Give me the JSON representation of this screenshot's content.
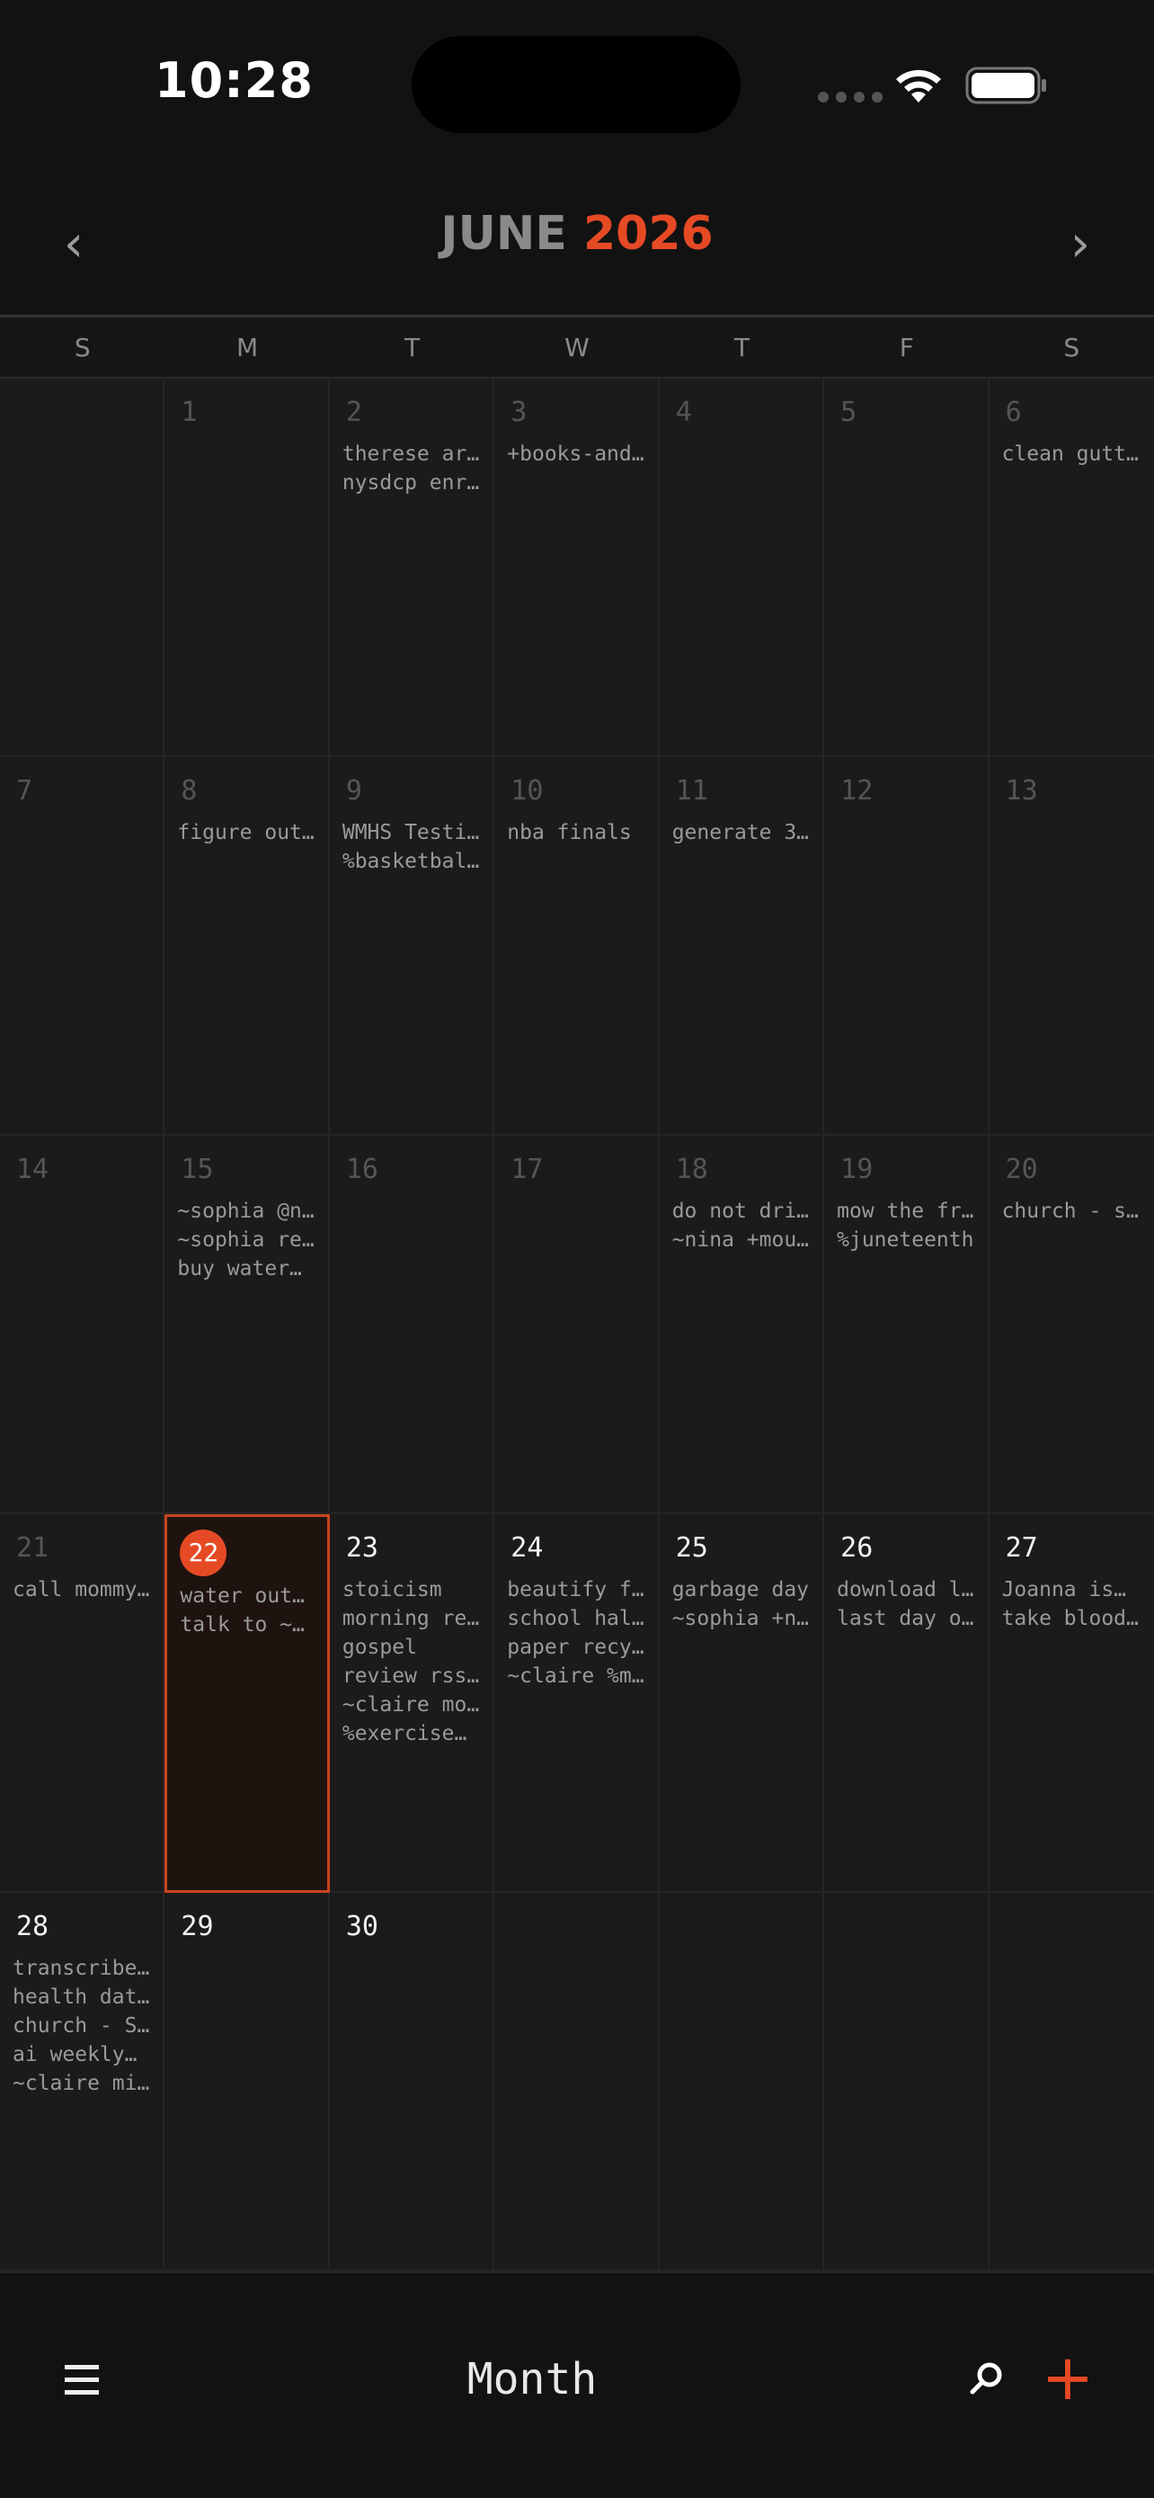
{
  "status": {
    "time": "10:28"
  },
  "header": {
    "month": "JUNE",
    "year": "2026",
    "prev": "‹",
    "next": "›"
  },
  "weekdays": [
    "S",
    "M",
    "T",
    "W",
    "T",
    "F",
    "S"
  ],
  "days": [
    {
      "num": "",
      "events": []
    },
    {
      "num": "1",
      "events": []
    },
    {
      "num": "2",
      "events": [
        "therese ar…",
        "nysdcp enr…"
      ]
    },
    {
      "num": "3",
      "events": [
        "+books-and…"
      ]
    },
    {
      "num": "4",
      "events": []
    },
    {
      "num": "5",
      "events": []
    },
    {
      "num": "6",
      "events": [
        "clean gutt…"
      ]
    },
    {
      "num": "7",
      "events": []
    },
    {
      "num": "8",
      "events": [
        "figure out…"
      ]
    },
    {
      "num": "9",
      "events": [
        "WMHS Testi…",
        "%basketbal…"
      ]
    },
    {
      "num": "10",
      "events": [
        "nba finals"
      ]
    },
    {
      "num": "11",
      "events": [
        "generate 3…"
      ]
    },
    {
      "num": "12",
      "events": []
    },
    {
      "num": "13",
      "events": []
    },
    {
      "num": "14",
      "events": []
    },
    {
      "num": "15",
      "events": [
        "~sophia @n…",
        "~sophia re…",
        "buy water…"
      ]
    },
    {
      "num": "16",
      "events": []
    },
    {
      "num": "17",
      "events": []
    },
    {
      "num": "18",
      "events": [
        "do not dri…",
        "~nina +mou…"
      ]
    },
    {
      "num": "19",
      "events": [
        "mow the fr…",
        "%juneteenth"
      ]
    },
    {
      "num": "20",
      "events": [
        "church - s…"
      ]
    },
    {
      "num": "21",
      "events": [
        "call mommy…"
      ]
    },
    {
      "num": "22",
      "today": true,
      "events": [
        "water outd…",
        "talk to ~s…"
      ]
    },
    {
      "num": "23",
      "current": true,
      "events": [
        "stoicism",
        "morning re…",
        "gospel",
        "review rss…",
        "~claire mo…",
        "%exercise…"
      ]
    },
    {
      "num": "24",
      "current": true,
      "events": [
        "beautify f…",
        "school hal…",
        "paper recy…",
        "~claire %m…"
      ]
    },
    {
      "num": "25",
      "current": true,
      "events": [
        "garbage day",
        "~sophia +n…"
      ]
    },
    {
      "num": "26",
      "current": true,
      "events": [
        "download l…",
        "last day o…"
      ]
    },
    {
      "num": "27",
      "current": true,
      "events": [
        "Joanna is…",
        "take blood…"
      ]
    },
    {
      "num": "28",
      "current": true,
      "events": [
        "transcribe…",
        "health dat…",
        "church - S…",
        "ai weekly…",
        "~claire mi…"
      ]
    },
    {
      "num": "29",
      "current": true,
      "events": []
    },
    {
      "num": "30",
      "current": true,
      "events": []
    },
    {
      "num": "",
      "events": []
    },
    {
      "num": "",
      "events": []
    },
    {
      "num": "",
      "events": []
    },
    {
      "num": "",
      "events": []
    }
  ],
  "bottom": {
    "view_label": "Month",
    "menu_icon": "hamburger-menu-icon",
    "search_icon": "search-icon",
    "add_icon": "plus-icon",
    "add_label": "+"
  },
  "colors": {
    "accent": "#e64a25",
    "background": "#121212",
    "cell": "#1b1b1b"
  }
}
